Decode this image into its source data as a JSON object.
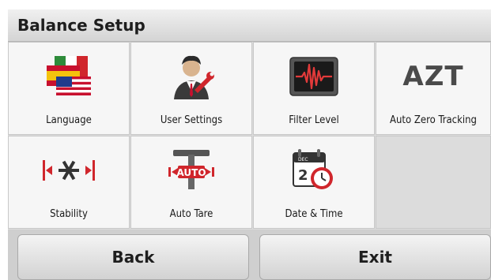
{
  "header": {
    "title": "Balance Setup"
  },
  "tiles": [
    {
      "label": "Language",
      "icon": "flags-icon"
    },
    {
      "label": "User Settings",
      "icon": "user-wrench-icon"
    },
    {
      "label": "Filter Level",
      "icon": "waveform-icon"
    },
    {
      "label": "Auto Zero Tracking",
      "icon": "azt-icon",
      "icon_text": "AZT"
    },
    {
      "label": "Stability",
      "icon": "stability-icon"
    },
    {
      "label": "Auto Tare",
      "icon": "auto-tare-icon",
      "icon_text": "AUTO"
    },
    {
      "label": "Date & Time",
      "icon": "calendar-clock-icon",
      "icon_text": "DEC",
      "day_digit": "2"
    }
  ],
  "footer": {
    "back_label": "Back",
    "exit_label": "Exit"
  },
  "colors": {
    "accent_red": "#d0262c",
    "tile_bg": "#f6f6f6",
    "screen_bg": "#dcdcdc"
  }
}
